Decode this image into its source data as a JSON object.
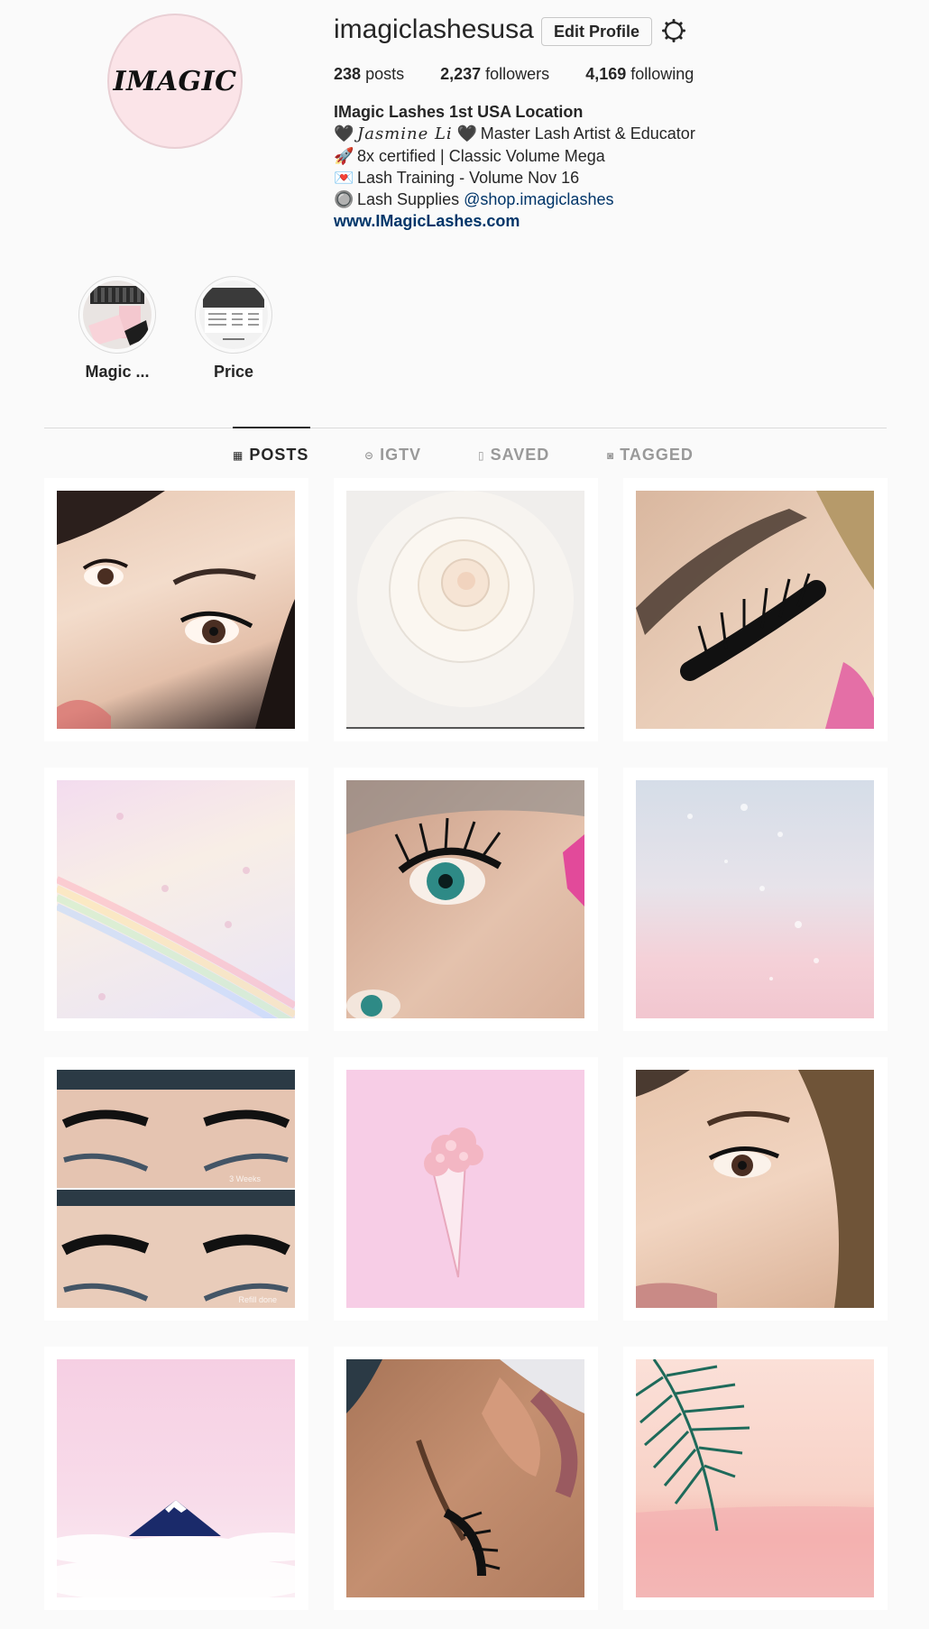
{
  "profile": {
    "avatar_text": "IMAGIC",
    "username": "imagiclashesusa",
    "edit_button": "Edit Profile",
    "settings_icon": "gear-icon",
    "stats": {
      "posts_count": "238",
      "posts_label": "posts",
      "followers_count": "2,237",
      "followers_label": "followers",
      "following_count": "4,169",
      "following_label": "following"
    },
    "bio": {
      "name": "IMagic Lashes 1st USA Location",
      "line1_emoji": "🖤",
      "line1_script": "Jasmine Li",
      "line1_emoji2": "🖤",
      "line1_text": "Master Lash Artist & Educator",
      "line2_emoji": "🚀",
      "line2_text": "8x certified | Classic Volume Mega",
      "line3_emoji": "💌",
      "line3_text": "Lash Training - Volume Nov 16",
      "line4_emoji": "🔘",
      "line4_text": "Lash Supplies",
      "line4_mention": "@shop.imagiclashes",
      "website": "www.IMagicLashes.com"
    }
  },
  "highlights": [
    {
      "label": "Magic ..."
    },
    {
      "label": "Price"
    }
  ],
  "tabs": [
    {
      "label": "POSTS",
      "icon": "grid-icon",
      "active": true
    },
    {
      "label": "IGTV",
      "icon": "igtv-icon",
      "active": false
    },
    {
      "label": "SAVED",
      "icon": "bookmark-icon",
      "active": false
    },
    {
      "label": "TAGGED",
      "icon": "tag-icon",
      "active": false
    }
  ],
  "posts": [
    {
      "subject": "face-portrait"
    },
    {
      "subject": "white-rose"
    },
    {
      "subject": "eyelash-closeup"
    },
    {
      "subject": "pastel-rainbow"
    },
    {
      "subject": "green-eye-lashes"
    },
    {
      "subject": "pink-water"
    },
    {
      "subject": "lash-refill-comparison",
      "overlay_top": "3 Weeks",
      "overlay_bottom": "Refill done"
    },
    {
      "subject": "flower-ice-cream-cone"
    },
    {
      "subject": "selfie-lashes"
    },
    {
      "subject": "mountain-clouds"
    },
    {
      "subject": "lash-profile"
    },
    {
      "subject": "palm-leaf-beach"
    }
  ],
  "colors": {
    "background": "#fafafa",
    "text": "#262626",
    "link": "#003569",
    "muted": "#999999",
    "avatar_bg": "#fbe4e8"
  }
}
